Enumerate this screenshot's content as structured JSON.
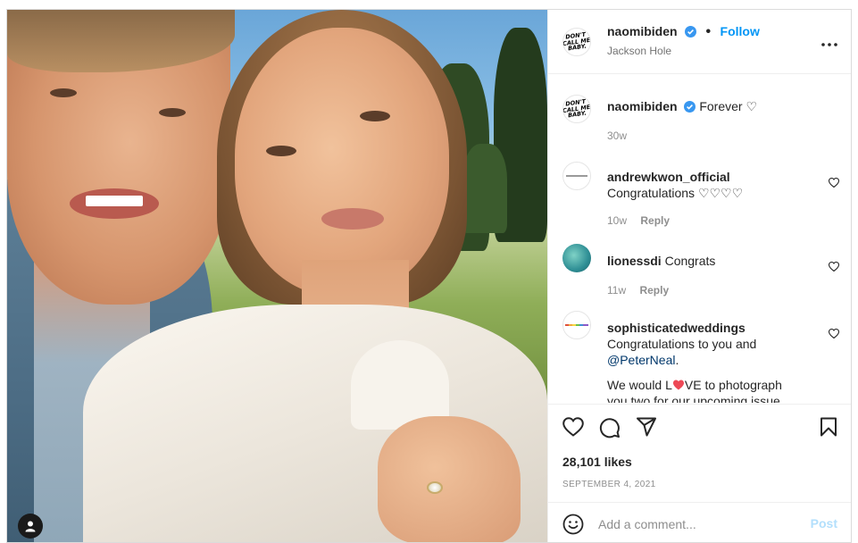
{
  "post": {
    "username": "naomibiden",
    "location": "Jackson Hole",
    "follow_label": "Follow",
    "dot": "•",
    "avatar_text": "DON'T\nCALL ME\nBABY.",
    "caption": {
      "username": "naomibiden",
      "text": "Forever ♡",
      "age": "30w"
    },
    "comments": [
      {
        "username": "andrewkwon_official",
        "text": "Congratulations ♡♡♡♡",
        "age": "10w",
        "reply_label": "Reply",
        "avatar": "andrewkwon-logo"
      },
      {
        "username": "lionessdi",
        "text": "Congrats",
        "age": "11w",
        "reply_label": "Reply",
        "avatar": "lioness-avatar"
      },
      {
        "username": "sophisticatedweddings",
        "line1": "Congratulations to you and",
        "mention": "@PeterNeal",
        "mention_after": ".",
        "line3a": "We would L",
        "line3b": "VE to photograph",
        "line4": "you two for our upcoming issue",
        "avatar": "weddings-logo"
      }
    ],
    "likes": "28,101 likes",
    "date": "SEPTEMBER 4, 2021",
    "add_comment_placeholder": "Add a comment...",
    "post_label": "Post",
    "colors": {
      "accent": "#0095f6",
      "verified": "#3897f0",
      "post_disabled": "#b2dffc",
      "heart_red": "#ed4956"
    }
  }
}
